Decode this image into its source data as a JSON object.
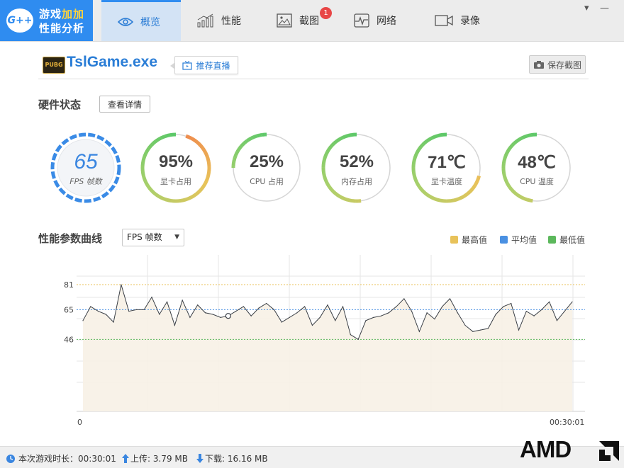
{
  "app": {
    "logo_badge": "G++",
    "title_line1_a": "游戏",
    "title_line1_b": "加加",
    "title_line2": "性能分析"
  },
  "tabs": [
    {
      "label": "概览",
      "icon": "eye-icon",
      "active": true
    },
    {
      "label": "性能",
      "icon": "bar-chart-icon"
    },
    {
      "label": "截图",
      "icon": "image-icon",
      "badge": "1"
    },
    {
      "label": "网络",
      "icon": "pulse-icon"
    },
    {
      "label": "录像",
      "icon": "video-icon"
    }
  ],
  "window_controls": {
    "menu": "▾",
    "minimize": "—"
  },
  "game": {
    "logo_text": "PUBG",
    "name": "TslGame.exe",
    "live_button": "推荐直播",
    "save_button": "保存截图"
  },
  "hardware": {
    "title": "硬件状态",
    "details_button": "查看详情",
    "fps": {
      "value": "65",
      "label": "FPS 帧数"
    },
    "gauges": [
      {
        "value": "95%",
        "label": "显卡占用",
        "percent": 95
      },
      {
        "value": "25%",
        "label": "CPU 占用",
        "percent": 25
      },
      {
        "value": "52%",
        "label": "内存占用",
        "percent": 52
      },
      {
        "value": "71℃",
        "label": "显卡温度",
        "percent": 71
      },
      {
        "value": "48℃",
        "label": "CPU 温度",
        "percent": 48
      }
    ]
  },
  "curve": {
    "title": "性能参数曲线",
    "select_value": "FPS 帧数",
    "legend": [
      {
        "label": "最高值",
        "color": "#e8c25a"
      },
      {
        "label": "平均值",
        "color": "#4a90e2"
      },
      {
        "label": "最低值",
        "color": "#5cb85c"
      }
    ]
  },
  "chart_data": {
    "type": "line",
    "series": [
      {
        "name": "FPS 帧数",
        "values": [
          58,
          67,
          64,
          62,
          57,
          81,
          64,
          65,
          65,
          73,
          62,
          70,
          55,
          71,
          60,
          68,
          63,
          62,
          60,
          61,
          64,
          67,
          61,
          66,
          69,
          65,
          57,
          60,
          63,
          67,
          55,
          60,
          68,
          58,
          67,
          49,
          46,
          58,
          60,
          61,
          63,
          67,
          72,
          64,
          51,
          63,
          59,
          67,
          72,
          63,
          55,
          51,
          52,
          53,
          62,
          67,
          69,
          52,
          64,
          61,
          65,
          70,
          58,
          64,
          70
        ]
      }
    ],
    "reference_lines": {
      "max": 81,
      "avg": 65,
      "min": 46
    },
    "y_ticks": [
      "81",
      "65",
      "46"
    ],
    "x_start_label": "0",
    "x_end_label": "00:30:01",
    "ylim": [
      0,
      100
    ]
  },
  "status": {
    "duration_label": "本次游戏时长：00:30:01",
    "upload_label": "上传: 3.79 MB",
    "download_label": "下载: 16.16 MB"
  },
  "brand": {
    "text": "AMD"
  }
}
